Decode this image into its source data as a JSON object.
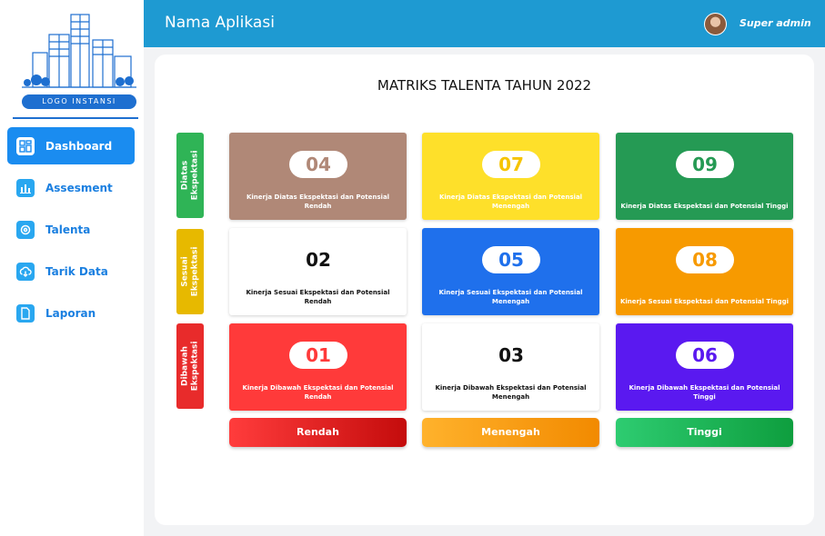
{
  "logo": {
    "text": "LOGO INSTANSI"
  },
  "sidebar": {
    "items": [
      {
        "label": "Dashboard",
        "icon": "dashboard-icon",
        "active": true
      },
      {
        "label": "Assesment",
        "icon": "bar-chart-icon",
        "active": false
      },
      {
        "label": "Talenta",
        "icon": "gear-icon",
        "active": false
      },
      {
        "label": "Tarik Data",
        "icon": "cloud-download-icon",
        "active": false
      },
      {
        "label": "Laporan",
        "icon": "document-icon",
        "active": false
      }
    ]
  },
  "header": {
    "title": "Nama Aplikasi",
    "user": "Super admin"
  },
  "main": {
    "title": "MATRIKS TALENTA TAHUN 2022",
    "rows": [
      {
        "label": "Diatas\nEkspektasi",
        "color": "#2fb456"
      },
      {
        "label": "Sesuai\nEkspektasi",
        "color": "#e7b900"
      },
      {
        "label": "Dibawah\nEkspektasi",
        "color": "#e82b2b"
      }
    ],
    "columns": [
      {
        "label": "Rendah",
        "gradient": [
          "#ff3c3c",
          "#c40c0c"
        ]
      },
      {
        "label": "Menengah",
        "gradient": [
          "#ffb22c",
          "#f28a00"
        ]
      },
      {
        "label": "Tinggi",
        "gradient": [
          "#2ecc71",
          "#0e9e3e"
        ]
      }
    ],
    "cells": [
      {
        "num": "04",
        "desc": "Kinerja Diatas Ekspektasi dan Potensial Rendah",
        "bg": "#b08877",
        "numColor": "#b08877"
      },
      {
        "num": "07",
        "desc": "Kinerja Diatas Ekspektasi dan Potensial Menengah",
        "bg": "#fee02a",
        "numColor": "#f6c400"
      },
      {
        "num": "09",
        "desc": "Kinerja Diatas Ekspektasi dan Potensial Tinggi",
        "bg": "#259a54",
        "numColor": "#259a54"
      },
      {
        "num": "02",
        "desc": "Kinerja Sesuai Ekspektasi dan Potensial Rendah",
        "bg": "#ffffff",
        "numColor": "#111111"
      },
      {
        "num": "05",
        "desc": "Kinerja Sesuai Ekspektasi dan Potensial Menengah",
        "bg": "#1f70ec",
        "numColor": "#1f70ec"
      },
      {
        "num": "08",
        "desc": "Kinerja Sesuai Ekspektasi dan Potensial Tinggi",
        "bg": "#f79a00",
        "numColor": "#f79a00"
      },
      {
        "num": "01",
        "desc": "Kinerja Dibawah Ekspektasi dan Potensial Rendah",
        "bg": "#ff3a3a",
        "numColor": "#ff3a3a"
      },
      {
        "num": "03",
        "desc": "Kinerja Dibawah Ekspektasi dan Potensial Menengah",
        "bg": "#ffffff",
        "numColor": "#111111"
      },
      {
        "num": "06",
        "desc": "Kinerja Dibawah Ekspektasi dan Potensial Tinggi",
        "bg": "#5a19f0",
        "numColor": "#5a19f0"
      }
    ]
  }
}
